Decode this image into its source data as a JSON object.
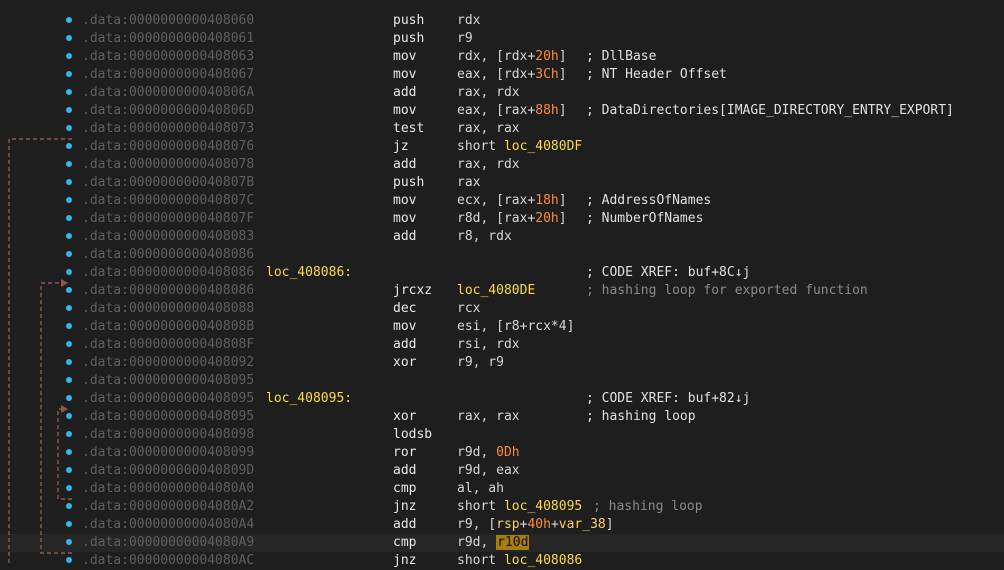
{
  "rows": [
    {
      "dot": false,
      "addr": "",
      "label": "",
      "mnem": "",
      "ops": "",
      "comment": ""
    },
    {
      "dot": true,
      "addr": ".data:0000000000408060",
      "label": "",
      "mnem": "push",
      "ops": [
        {
          "t": "rdx",
          "c": ""
        }
      ],
      "comment": "",
      "cdim": false
    },
    {
      "dot": true,
      "addr": ".data:0000000000408061",
      "label": "",
      "mnem": "push",
      "ops": [
        {
          "t": "r9",
          "c": ""
        }
      ],
      "comment": ""
    },
    {
      "dot": true,
      "addr": ".data:0000000000408063",
      "label": "",
      "mnem": "mov",
      "ops": [
        {
          "t": "rdx, [rdx+",
          "c": ""
        },
        {
          "t": "20h",
          "c": "n"
        },
        {
          "t": "]",
          "c": ""
        }
      ],
      "comment": "; DllBase"
    },
    {
      "dot": true,
      "addr": ".data:0000000000408067",
      "label": "",
      "mnem": "mov",
      "ops": [
        {
          "t": "eax, [rdx+",
          "c": ""
        },
        {
          "t": "3Ch",
          "c": "n"
        },
        {
          "t": "]",
          "c": ""
        }
      ],
      "comment": "; NT Header Offset"
    },
    {
      "dot": true,
      "addr": ".data:000000000040806A",
      "label": "",
      "mnem": "add",
      "ops": [
        {
          "t": "rax, rdx",
          "c": ""
        }
      ],
      "comment": ""
    },
    {
      "dot": true,
      "addr": ".data:000000000040806D",
      "label": "",
      "mnem": "mov",
      "ops": [
        {
          "t": "eax, [rax+",
          "c": ""
        },
        {
          "t": "88h",
          "c": "n"
        },
        {
          "t": "]",
          "c": ""
        }
      ],
      "comment": "; DataDirectories[IMAGE_DIRECTORY_ENTRY_EXPORT]"
    },
    {
      "dot": true,
      "addr": ".data:0000000000408073",
      "label": "",
      "mnem": "test",
      "ops": [
        {
          "t": "rax, rax",
          "c": ""
        }
      ],
      "comment": ""
    },
    {
      "dot": true,
      "addr": ".data:0000000000408076",
      "label": "",
      "mnem": "jz",
      "ops": [
        {
          "t": "short ",
          "c": ""
        },
        {
          "t": "loc_4080DF",
          "c": "l"
        }
      ],
      "comment": ""
    },
    {
      "dot": true,
      "addr": ".data:0000000000408078",
      "label": "",
      "mnem": "add",
      "ops": [
        {
          "t": "rax, rdx",
          "c": ""
        }
      ],
      "comment": ""
    },
    {
      "dot": true,
      "addr": ".data:000000000040807B",
      "label": "",
      "mnem": "push",
      "ops": [
        {
          "t": "rax",
          "c": ""
        }
      ],
      "comment": ""
    },
    {
      "dot": true,
      "addr": ".data:000000000040807C",
      "label": "",
      "mnem": "mov",
      "ops": [
        {
          "t": "ecx, [rax+",
          "c": ""
        },
        {
          "t": "18h",
          "c": "n"
        },
        {
          "t": "]",
          "c": ""
        }
      ],
      "comment": "; AddressOfNames"
    },
    {
      "dot": true,
      "addr": ".data:000000000040807F",
      "label": "",
      "mnem": "mov",
      "ops": [
        {
          "t": "r8d, [rax+",
          "c": ""
        },
        {
          "t": "20h",
          "c": "n"
        },
        {
          "t": "]",
          "c": ""
        }
      ],
      "comment": "; NumberOfNames"
    },
    {
      "dot": true,
      "addr": ".data:0000000000408083",
      "label": "",
      "mnem": "add",
      "ops": [
        {
          "t": "r8, rdx",
          "c": ""
        }
      ],
      "comment": ""
    },
    {
      "dot": true,
      "addr": ".data:0000000000408086",
      "label": "",
      "mnem": "",
      "ops": [],
      "comment": ""
    },
    {
      "dot": true,
      "addr": ".data:0000000000408086",
      "label": "loc_408086:",
      "mnem": "",
      "ops": [],
      "comment": "; CODE XREF: buf+8C↓j",
      "cx": true
    },
    {
      "dot": true,
      "addr": ".data:0000000000408086",
      "label": "",
      "mnem": "jrcxz",
      "ops": [
        {
          "t": "loc_4080DE",
          "c": "l"
        }
      ],
      "comment": "; hashing loop for exported function",
      "cdim": true
    },
    {
      "dot": true,
      "addr": ".data:0000000000408088",
      "label": "",
      "mnem": "dec",
      "ops": [
        {
          "t": "rcx",
          "c": ""
        }
      ],
      "comment": ""
    },
    {
      "dot": true,
      "addr": ".data:000000000040808B",
      "label": "",
      "mnem": "mov",
      "ops": [
        {
          "t": "esi, [r8+rcx*4]",
          "c": ""
        }
      ],
      "comment": ""
    },
    {
      "dot": true,
      "addr": ".data:000000000040808F",
      "label": "",
      "mnem": "add",
      "ops": [
        {
          "t": "rsi, rdx",
          "c": ""
        }
      ],
      "comment": ""
    },
    {
      "dot": true,
      "addr": ".data:0000000000408092",
      "label": "",
      "mnem": "xor",
      "ops": [
        {
          "t": "r9, r9",
          "c": ""
        }
      ],
      "comment": ""
    },
    {
      "dot": true,
      "addr": ".data:0000000000408095",
      "label": "",
      "mnem": "",
      "ops": [],
      "comment": ""
    },
    {
      "dot": true,
      "addr": ".data:0000000000408095",
      "label": "loc_408095:",
      "mnem": "",
      "ops": [],
      "comment": "; CODE XREF: buf+82↓j",
      "cx": true
    },
    {
      "dot": true,
      "addr": ".data:0000000000408095",
      "label": "",
      "mnem": "xor",
      "ops": [
        {
          "t": "rax, rax",
          "c": ""
        }
      ],
      "comment": "; hashing loop"
    },
    {
      "dot": true,
      "addr": ".data:0000000000408098",
      "label": "",
      "mnem": "lodsb",
      "ops": [],
      "comment": ""
    },
    {
      "dot": true,
      "addr": ".data:0000000000408099",
      "label": "",
      "mnem": "ror",
      "ops": [
        {
          "t": "r9d, ",
          "c": ""
        },
        {
          "t": "0Dh",
          "c": "n"
        }
      ],
      "comment": ""
    },
    {
      "dot": true,
      "addr": ".data:000000000040809D",
      "label": "",
      "mnem": "add",
      "ops": [
        {
          "t": "r9d, eax",
          "c": ""
        }
      ],
      "comment": ""
    },
    {
      "dot": true,
      "addr": ".data:00000000004080A0",
      "label": "",
      "mnem": "cmp",
      "ops": [
        {
          "t": "al, ah",
          "c": ""
        }
      ],
      "comment": ""
    },
    {
      "dot": true,
      "addr": ".data:00000000004080A2",
      "label": "",
      "mnem": "jnz",
      "ops": [
        {
          "t": "short ",
          "c": ""
        },
        {
          "t": "loc_408095",
          "c": "l"
        }
      ],
      "comment": "; hashing loop",
      "cdim": true
    },
    {
      "dot": true,
      "addr": ".data:00000000004080A4",
      "label": "",
      "mnem": "add",
      "ops": [
        {
          "t": "r9, [",
          "c": ""
        },
        {
          "t": "rsp",
          "c": "k"
        },
        {
          "t": "+",
          "c": ""
        },
        {
          "t": "40h",
          "c": "n"
        },
        {
          "t": "+",
          "c": ""
        },
        {
          "t": "var_38",
          "c": "k"
        },
        {
          "t": "]",
          "c": ""
        }
      ],
      "comment": ""
    },
    {
      "dot": true,
      "addr": ".data:00000000004080A9",
      "label": "",
      "mnem": "cmp",
      "ops": [
        {
          "t": "r9d, ",
          "c": ""
        },
        {
          "t": "r10d",
          "c": "box"
        }
      ],
      "comment": "",
      "hl": true
    },
    {
      "dot": true,
      "addr": ".data:00000000004080AC",
      "label": "",
      "mnem": "jnz",
      "ops": [
        {
          "t": "short ",
          "c": ""
        },
        {
          "t": "loc_408086",
          "c": "l"
        }
      ],
      "comment": ""
    }
  ],
  "colors": {
    "background": "#1e1e1e",
    "dot": "#35b5e8",
    "label": "#ffd84a",
    "number": "#ff8a3d",
    "arrow": "#8b5a4a"
  }
}
